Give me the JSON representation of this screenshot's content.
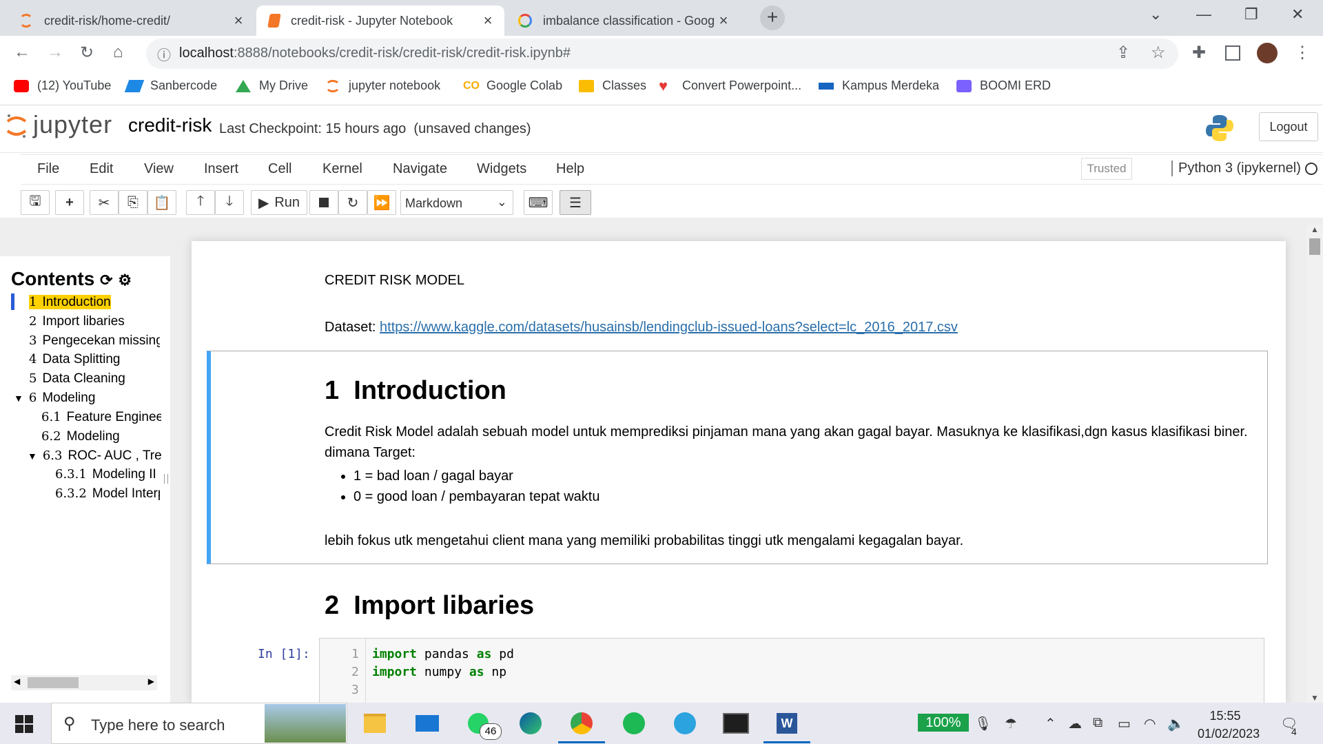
{
  "browser": {
    "tabs": [
      {
        "title": "credit-risk/home-credit/",
        "active": false,
        "icon": "jupyter-icon"
      },
      {
        "title": "credit-risk - Jupyter Notebook",
        "active": true,
        "icon": "notebook-icon"
      },
      {
        "title": "imbalance classification - Google",
        "active": false,
        "icon": "google-icon"
      }
    ],
    "url_host": "localhost",
    "url_path": ":8888/notebooks/credit-risk/credit-risk/credit-risk.ipynb#",
    "bookmarks": [
      {
        "label": "(12) YouTube",
        "icon": "youtube-icon",
        "color": "#ff0000"
      },
      {
        "label": "Sanbercode",
        "icon": "sanbercode-icon",
        "color": "#1e88e5"
      },
      {
        "label": "My Drive",
        "icon": "drive-icon",
        "color": "#34a853"
      },
      {
        "label": "jupyter notebook",
        "icon": "jupyter-icon",
        "color": "#f37726"
      },
      {
        "label": "Google Colab",
        "icon": "colab-icon",
        "color": "#f9ab00"
      },
      {
        "label": "Classes",
        "icon": "classroom-icon",
        "color": "#fbbc04"
      },
      {
        "label": "Convert Powerpoint...",
        "icon": "heart-icon",
        "color": "#e53935"
      },
      {
        "label": "Kampus Merdeka",
        "icon": "kampus-merdeka-icon",
        "color": "#1565c0"
      },
      {
        "label": "BOOMI ERD",
        "icon": "boomi-icon",
        "color": "#7b61ff"
      }
    ]
  },
  "jupyter": {
    "logo_text": "jupyter",
    "notebook_name": "credit-risk",
    "checkpoint": "Last Checkpoint: 15 hours ago",
    "unsaved": "(unsaved changes)",
    "logout": "Logout",
    "menu": [
      "File",
      "Edit",
      "View",
      "Insert",
      "Cell",
      "Kernel",
      "Navigate",
      "Widgets",
      "Help"
    ],
    "trusted": "Trusted",
    "kernel": "Python 3 (ipykernel)",
    "run_label": "Run",
    "cell_type": "Markdown"
  },
  "toc": {
    "title": "Contents",
    "items": [
      {
        "num": "1",
        "label": "Introduction"
      },
      {
        "num": "2",
        "label": "Import libaries"
      },
      {
        "num": "3",
        "label": "Pengecekan missing"
      },
      {
        "num": "4",
        "label": "Data Splitting"
      },
      {
        "num": "5",
        "label": "Data Cleaning"
      },
      {
        "num": "6",
        "label": "Modeling"
      },
      {
        "num": "6.1",
        "label": "Feature Engineering"
      },
      {
        "num": "6.2",
        "label": "Modeling"
      },
      {
        "num": "6.3",
        "label": "ROC- AUC , Treshold"
      },
      {
        "num": "6.3.1",
        "label": "Modeling II"
      },
      {
        "num": "6.3.2",
        "label": "Model Interpretation"
      }
    ]
  },
  "notebook": {
    "model_title": "CREDIT RISK MODEL",
    "dataset_label": "Dataset:",
    "dataset_url": "https://www.kaggle.com/datasets/husainsb/lendingclub-issued-loans?select=lc_2016_2017.csv",
    "intro_num": "1",
    "intro_heading": "Introduction",
    "intro_para": "Credit Risk Model adalah sebuah model untuk memprediksi pinjaman mana yang akan gagal bayar. Masuknya ke klasifikasi,dgn kasus klasifikasi biner. dimana Target:",
    "bullets": [
      "1 = bad loan / gagal bayar",
      "0 = good loan / pembayaran tepat waktu"
    ],
    "intro_footer": "lebih fokus utk mengetahui client mana yang memiliki probabilitas tinggi utk mengalami kegagalan bayar.",
    "import_num": "2",
    "import_heading": "Import libaries",
    "prompt": "In [1]:",
    "code": [
      {
        "n": "1",
        "kw1": "import",
        "mod": " pandas ",
        "kw2": "as",
        "alias": " pd"
      },
      {
        "n": "2",
        "kw1": "import",
        "mod": " numpy ",
        "kw2": "as",
        "alias": " np"
      },
      {
        "n": "3",
        "kw1": "",
        "mod": "",
        "kw2": "",
        "alias": ""
      }
    ]
  },
  "taskbar": {
    "search_placeholder": "Type here to search",
    "whatsapp_badge": "46",
    "battery": "100%",
    "time": "15:55",
    "date": "01/02/2023",
    "notifications": "4"
  }
}
